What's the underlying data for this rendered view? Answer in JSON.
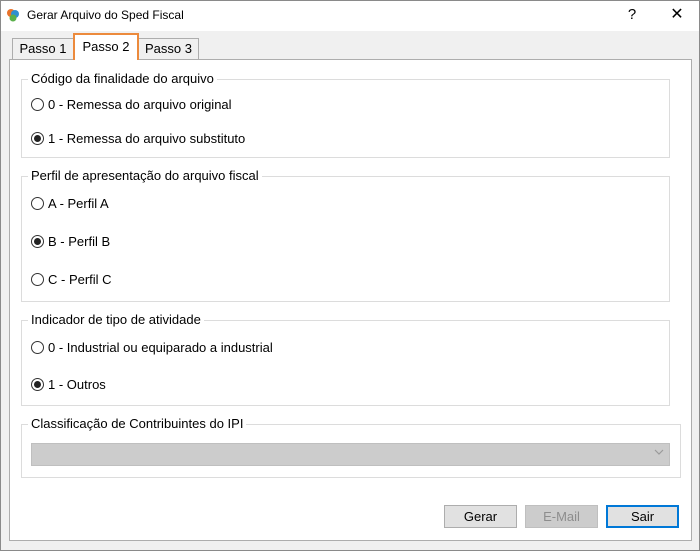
{
  "window": {
    "title": "Gerar Arquivo do Sped Fiscal",
    "help": "?",
    "close": "✕"
  },
  "tabs": [
    {
      "label": "Passo 1",
      "active": false
    },
    {
      "label": "Passo 2",
      "active": true
    },
    {
      "label": "Passo 3",
      "active": false
    }
  ],
  "groups": {
    "finalidade": {
      "title": "Código da finalidade do arquivo",
      "options": [
        {
          "label": "0 - Remessa do arquivo original",
          "checked": false
        },
        {
          "label": "1 - Remessa do arquivo substituto",
          "checked": true
        }
      ]
    },
    "perfil": {
      "title": "Perfil de apresentação do arquivo fiscal",
      "options": [
        {
          "label": "A - Perfil A",
          "checked": false
        },
        {
          "label": "B - Perfil B",
          "checked": true
        },
        {
          "label": "C - Perfil C",
          "checked": false
        }
      ]
    },
    "atividade": {
      "title": "Indicador de tipo de atividade",
      "options": [
        {
          "label": "0 - Industrial ou equiparado a industrial",
          "checked": false
        },
        {
          "label": "1 - Outros",
          "checked": true
        }
      ]
    },
    "ipi": {
      "title": "Classificação de Contribuintes do IPI",
      "selected": ""
    }
  },
  "buttons": {
    "gerar": "Gerar",
    "email": "E-Mail",
    "sair": "Sair"
  },
  "colors": {
    "active_tab_outline": "#ec8a3c",
    "default_button_border": "#0078d7"
  }
}
